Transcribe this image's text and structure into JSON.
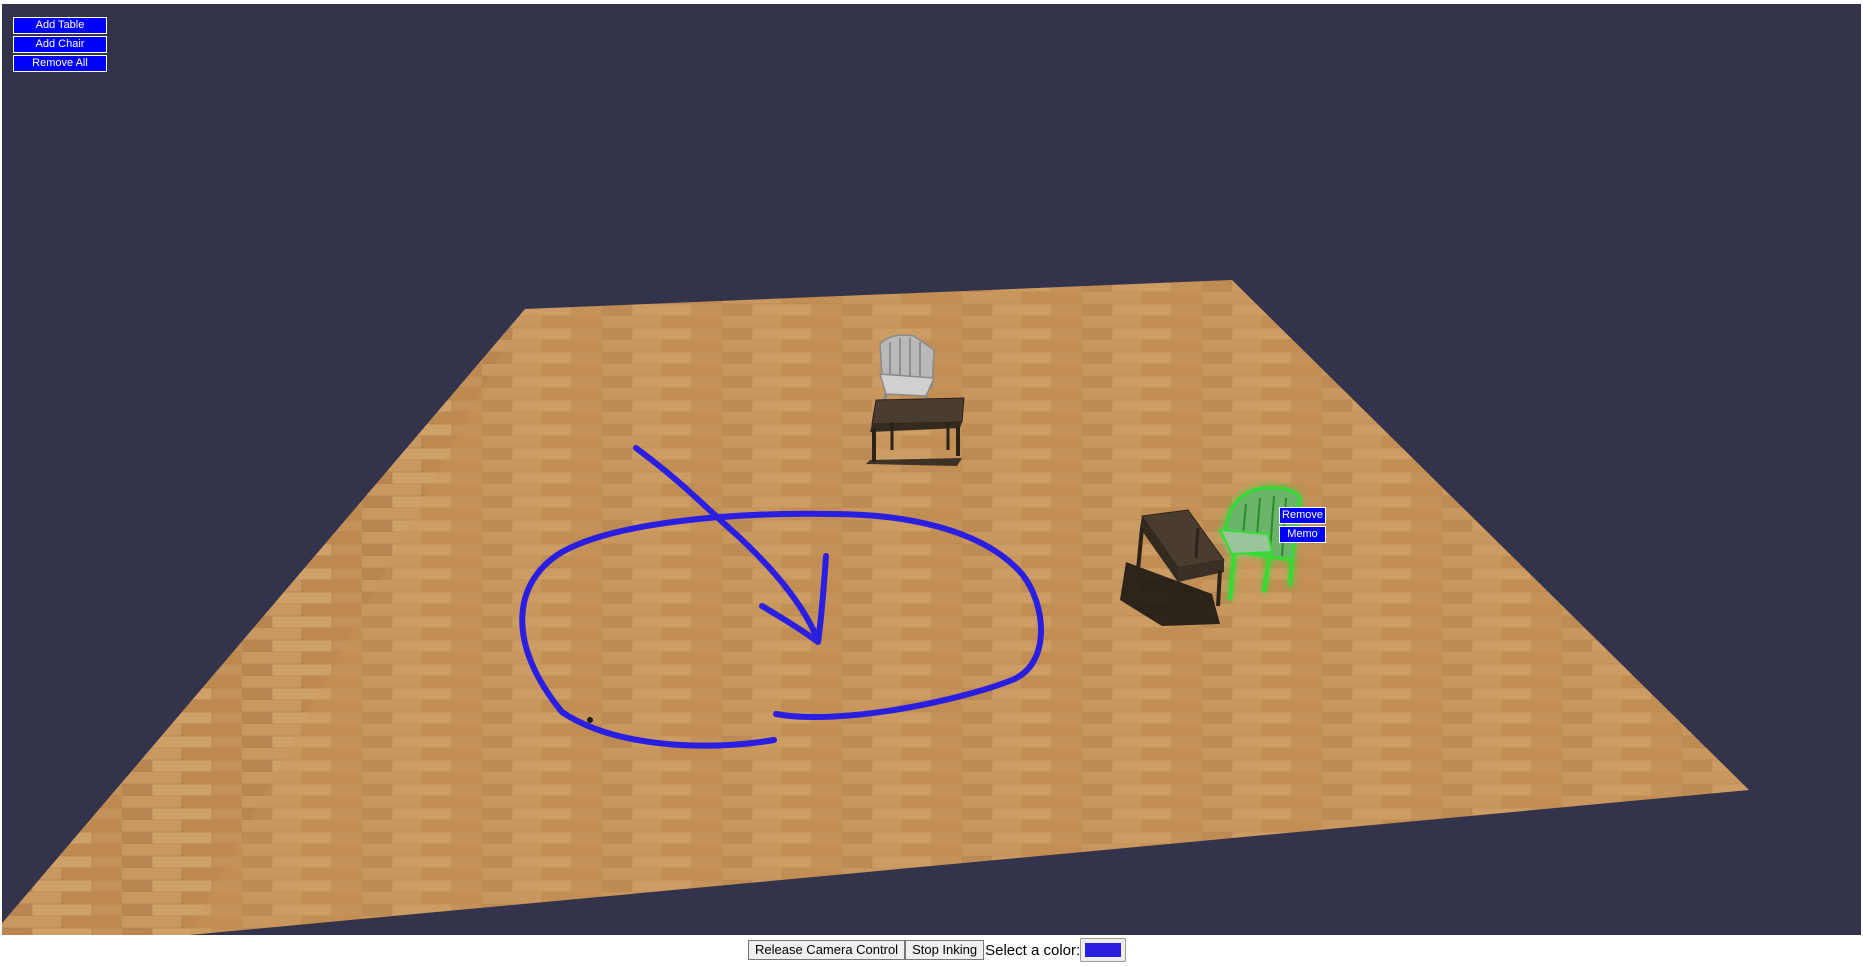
{
  "toolbar": {
    "add_table": "Add Table",
    "add_chair": "Add Chair",
    "remove_all": "Remove All"
  },
  "context_menu": {
    "remove": "Remove",
    "memo": "Memo"
  },
  "bottom_bar": {
    "release_camera": "Release Camera Control",
    "stop_inking": "Stop Inking",
    "color_label": "Select a color:",
    "selected_color": "#2a1ee0"
  },
  "colors": {
    "background": "#33334b",
    "floor": "#c8945a",
    "ink": "#2a1ee0",
    "selection_glow": "#33dd33",
    "ui_button": "#0000ff"
  },
  "scene_objects": [
    {
      "type": "chair",
      "state": "normal"
    },
    {
      "type": "table",
      "state": "normal"
    },
    {
      "type": "table",
      "state": "normal"
    },
    {
      "type": "chair",
      "state": "selected"
    }
  ]
}
